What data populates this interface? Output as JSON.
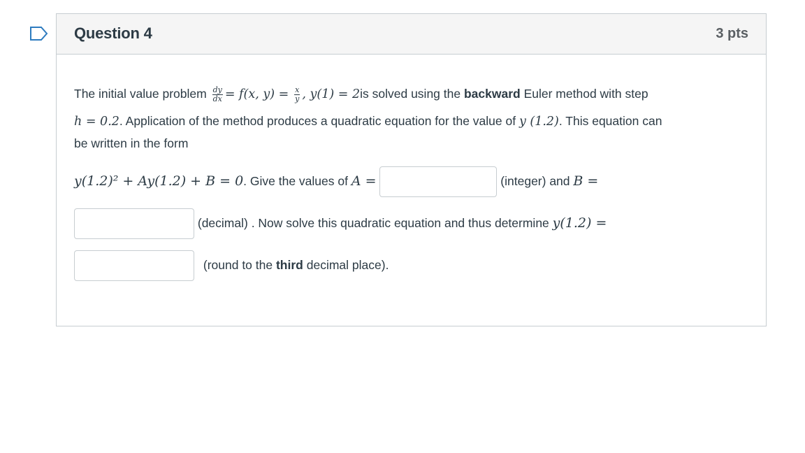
{
  "question": {
    "title": "Question 4",
    "points": "3 pts"
  },
  "body": {
    "intro": "The initial value problem",
    "ode_lhs_num": "dy",
    "ode_lhs_den": "dx",
    "ode_mid": "= f(x, y) =",
    "ode_rhs_num": "x",
    "ode_rhs_den": "y",
    "ode_ic": ",  y(1) = 2",
    "after_ic": "is solved using the",
    "method_bold": "backward",
    "after_method": "Euler method with step",
    "step": "h = 0.2",
    "line2_text": ". Application of the method produces a quadratic equation for the value of",
    "y12": "y (1.2)",
    "line2_end": ". This equation can",
    "line3_text": "be written in the form",
    "eq": "y(1.2)² + Ay(1.2) + B = 0",
    "give_values": ". Give the values of",
    "a_eq": "A =",
    "integer_and": "(integer) and",
    "b_eq": "B =",
    "decimal_now": "(decimal) . Now solve this quadratic equation and thus determine",
    "y12_eq": "y(1.2) =",
    "round_pre": "(round to the",
    "round_bold": "third",
    "round_post": "decimal place)."
  },
  "inputs": {
    "a_value": "",
    "b_value": "",
    "y_value": ""
  },
  "icons": {
    "flag": "bookmark-flag-icon"
  },
  "colors": {
    "text": "#2d3b45",
    "header_bg": "#f5f5f5",
    "border": "#c7cdd1",
    "flag": "#2d7bbf"
  }
}
